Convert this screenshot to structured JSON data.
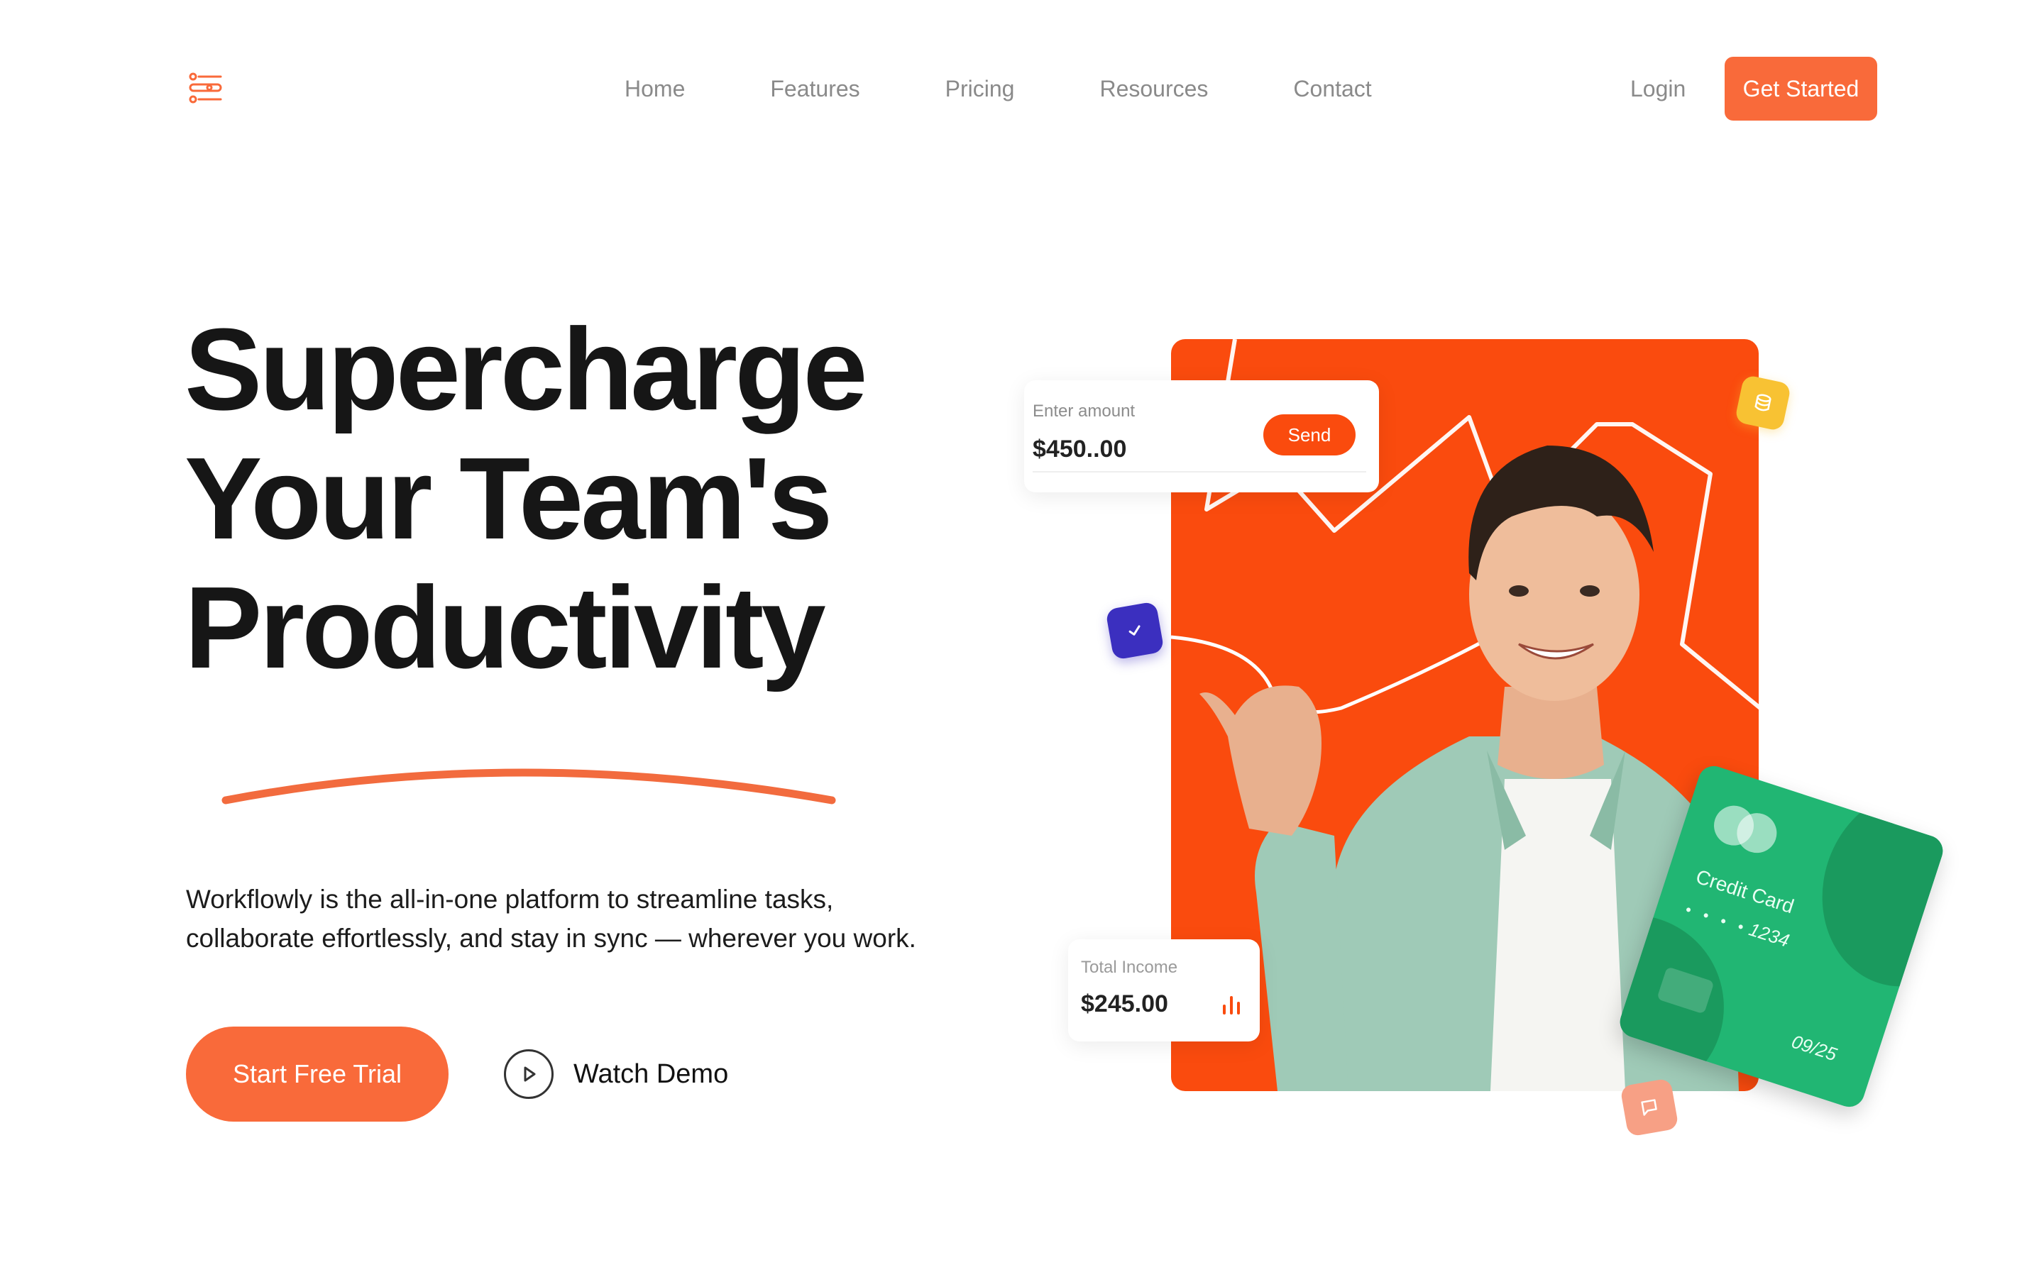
{
  "nav": {
    "links": [
      "Home",
      "Features",
      "Pricing",
      "Resources",
      "Contact"
    ],
    "login": "Login",
    "cta": "Get Started"
  },
  "hero": {
    "title_lines": [
      "Supercharge",
      "Your Team's",
      "Productivity"
    ],
    "description_lines": [
      "Workflowly is the all-in-one platform to streamline tasks,",
      "collaborate effortlessly, and stay in sync — wherever you work."
    ],
    "primary_cta": "Start Free Trial",
    "secondary_cta": "Watch Demo"
  },
  "amount_card": {
    "label": "Enter amount",
    "value": "$450..00",
    "send": "Send"
  },
  "income_card": {
    "label": "Total Income",
    "value": "$245.00"
  },
  "credit_card": {
    "title": "Credit Card",
    "dots": "• • • •",
    "number": "1234",
    "expiry": "09/25"
  },
  "colors": {
    "accent": "#f96a3a",
    "panel": "#fa4b0e",
    "card_green": "#21b673",
    "chip_yellow": "#f8c233",
    "chip_purple": "#3b2fbf",
    "chip_pink": "#f7a085"
  },
  "icons": {
    "logo": "list-toggle-icon",
    "play": "play-icon",
    "check": "check-icon",
    "coins": "coins-icon",
    "message": "message-icon",
    "bar_chart": "bar-chart-icon"
  }
}
